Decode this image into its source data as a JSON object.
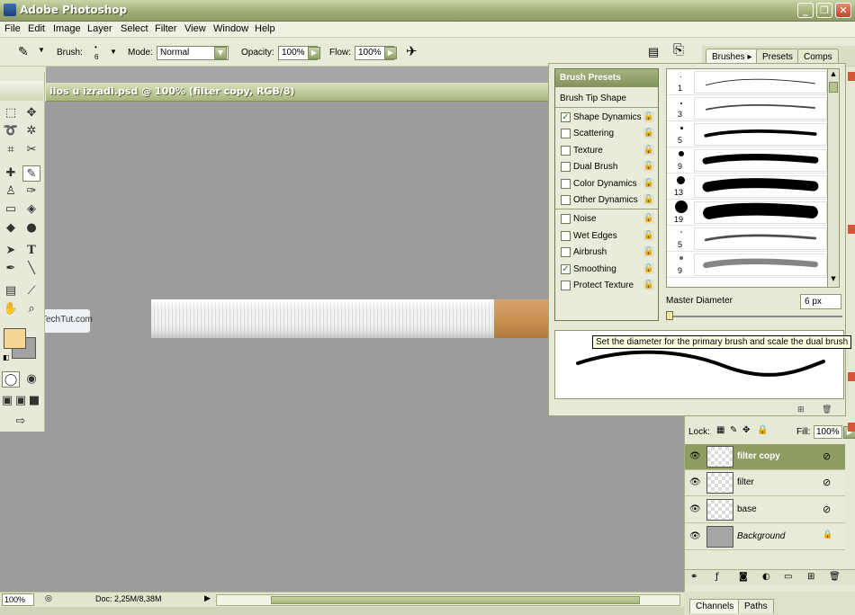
{
  "app": {
    "title": "Adobe Photoshop"
  },
  "window_buttons": {
    "minimize": "_",
    "restore": "❐",
    "close": "✕"
  },
  "menu": [
    "File",
    "Edit",
    "Image",
    "Layer",
    "Select",
    "Filter",
    "View",
    "Window",
    "Help"
  ],
  "options": {
    "brush_label": "Brush:",
    "brush_size": "6",
    "mode_label": "Mode:",
    "mode_value": "Normal",
    "opacity_label": "Opacity:",
    "opacity_value": "100%",
    "flow_label": "Flow:",
    "flow_value": "100%"
  },
  "palette_well": {
    "tabs": [
      "Brushes",
      "Presets",
      "Comps"
    ]
  },
  "document": {
    "title": "ilos u izradi.psd @ 100% (filter copy, RGB/8)"
  },
  "watermark": {
    "text": "TechTut.com"
  },
  "brushes_panel": {
    "header": "Brush Presets",
    "tip_shape": "Brush Tip Shape",
    "options": [
      {
        "label": "Shape Dynamics",
        "checked": true
      },
      {
        "label": "Scattering",
        "checked": false
      },
      {
        "label": "Texture",
        "checked": false
      },
      {
        "label": "Dual Brush",
        "checked": false
      },
      {
        "label": "Color Dynamics",
        "checked": false
      },
      {
        "label": "Other Dynamics",
        "checked": false
      }
    ],
    "extras": [
      {
        "label": "Noise",
        "checked": false
      },
      {
        "label": "Wet Edges",
        "checked": false
      },
      {
        "label": "Airbrush",
        "checked": false
      },
      {
        "label": "Smoothing",
        "checked": true
      },
      {
        "label": "Protect Texture",
        "checked": false
      }
    ],
    "brush_sizes": [
      "1",
      "3",
      "5",
      "9",
      "13",
      "19",
      "5",
      "9"
    ],
    "master_diameter_label": "Master Diameter",
    "master_diameter_value": "6 px",
    "tooltip": "Set the diameter for the primary brush and scale the dual brush"
  },
  "layers_panel": {
    "lock_label": "Lock:",
    "fill_label": "Fill:",
    "fill_value": "100%",
    "layers": [
      {
        "name": "filter copy",
        "active": true,
        "type": "transparent"
      },
      {
        "name": "filter",
        "active": false,
        "type": "transparent"
      },
      {
        "name": "base",
        "active": false,
        "type": "transparent"
      },
      {
        "name": "Background",
        "active": false,
        "type": "background"
      }
    ]
  },
  "channels_panel": {
    "tabs": [
      "Channels",
      "Paths"
    ]
  },
  "status": {
    "zoom": "100%",
    "doc_info": "Doc: 2,25M/8,38M"
  },
  "colors": {
    "foreground": "#f6d693",
    "background": "#a2a2a2",
    "cigarette_filter": "#c7904f",
    "theme_olive": "#8e9e62"
  }
}
